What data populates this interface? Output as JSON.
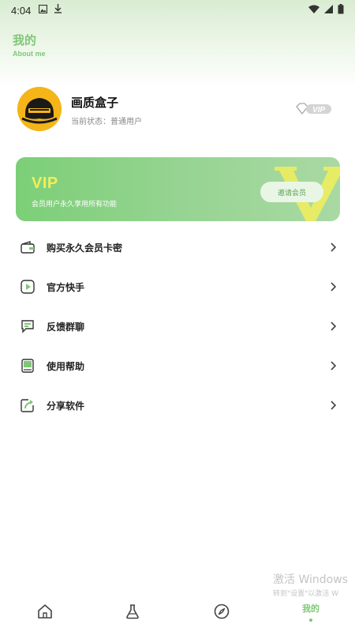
{
  "status_bar": {
    "time": "4:04"
  },
  "header": {
    "title": "我的",
    "subtitle": "About me"
  },
  "profile": {
    "name": "画质盒子",
    "status": "当前状态：普通用户",
    "badge": "VIP"
  },
  "vip_card": {
    "title": "VIP",
    "description": "会员用户永久享用所有功能",
    "button": "邀请会员"
  },
  "menu": {
    "items": [
      {
        "label": "购买永久会员卡密",
        "icon": "wallet-icon"
      },
      {
        "label": "官方快手",
        "icon": "video-play-icon"
      },
      {
        "label": "反馈群聊",
        "icon": "chat-icon"
      },
      {
        "label": "使用帮助",
        "icon": "book-icon"
      },
      {
        "label": "分享软件",
        "icon": "share-icon"
      }
    ]
  },
  "tab_bar": {
    "tabs": [
      {
        "icon": "home-icon"
      },
      {
        "icon": "flask-icon"
      },
      {
        "icon": "compass-icon"
      },
      {
        "label": "我的",
        "active": true
      }
    ]
  },
  "watermark": {
    "line1": "激活 Windows",
    "line2": "转到\"设置\"以激活 W"
  },
  "colors": {
    "accent": "#7fc777",
    "vip_text": "#f2ee5b",
    "card_start": "#7ccf77",
    "card_end": "#a9d9a3"
  }
}
